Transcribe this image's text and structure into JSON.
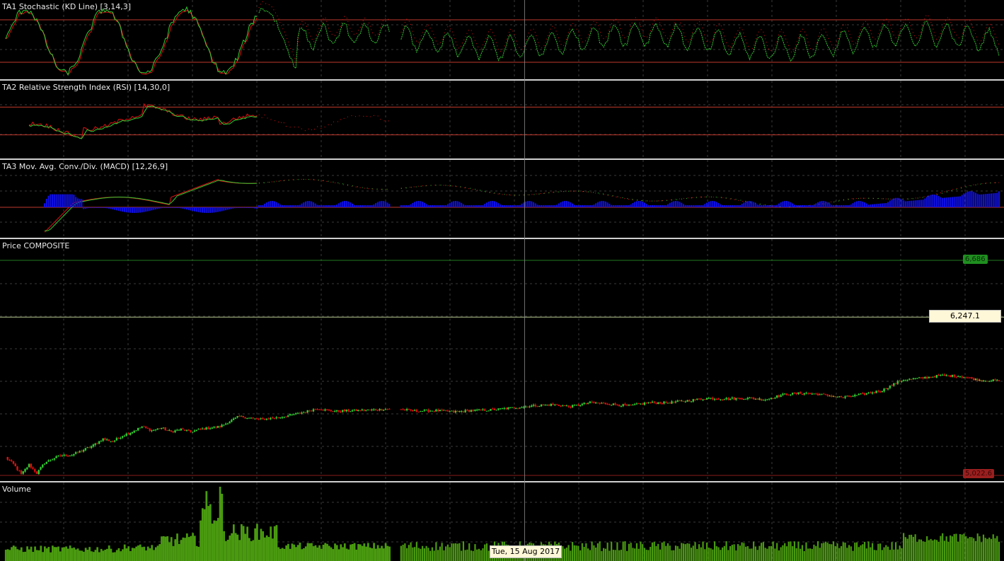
{
  "panels": {
    "stochastic": {
      "title": "TA1 Stochastic (KD Line) [3,14,3]",
      "upper_level": 80,
      "lower_level": 20
    },
    "rsi": {
      "title": "TA2 Relative Strength Index (RSI) [14,30,0]",
      "upper_level": 70,
      "lower_level": 30
    },
    "macd": {
      "title": "TA3 Mov. Avg. Conv./Div. (MACD) [12,26,9]"
    },
    "price": {
      "title": "Price COMPOSITE",
      "high_label": "6,686",
      "low_label": "5,022.6",
      "cursor_value": "6,247.1"
    },
    "volume": {
      "title": "Volume"
    }
  },
  "crosshair": {
    "date_label": "Tue, 15 Aug 2017"
  },
  "colors": {
    "up": "#33cc33",
    "down": "#e01010",
    "volume": "#4a9a10",
    "macd_hist": "#1010ee",
    "level_line": "#c0392b",
    "grid": "#3a3a3a"
  },
  "chart_data": [
    {
      "type": "candlestick",
      "title": "Price COMPOSITE",
      "ylim": [
        5022.6,
        6686
      ],
      "labels": {
        "high": "6,686",
        "low": "5,022.6",
        "cursor": "6,247.1"
      },
      "anchors": [
        [
          0,
          5160
        ],
        [
          4,
          5110
        ],
        [
          8,
          5030
        ],
        [
          12,
          5105
        ],
        [
          16,
          5040
        ],
        [
          20,
          5120
        ],
        [
          24,
          5150
        ],
        [
          28,
          5175
        ],
        [
          34,
          5180
        ],
        [
          40,
          5220
        ],
        [
          45,
          5255
        ],
        [
          50,
          5305
        ],
        [
          55,
          5285
        ],
        [
          60,
          5330
        ],
        [
          65,
          5360
        ],
        [
          70,
          5400
        ],
        [
          75,
          5370
        ],
        [
          80,
          5390
        ],
        [
          85,
          5360
        ],
        [
          90,
          5380
        ],
        [
          95,
          5360
        ],
        [
          100,
          5380
        ],
        [
          110,
          5400
        ],
        [
          120,
          5480
        ],
        [
          130,
          5455
        ],
        [
          140,
          5470
        ],
        [
          150,
          5500
        ],
        [
          160,
          5540
        ],
        [
          165,
          5525
        ],
        [
          170,
          5520
        ],
        [
          190,
          5530
        ],
        [
          200,
          5540
        ],
        [
          210,
          5520
        ],
        [
          220,
          5525
        ],
        [
          230,
          5515
        ],
        [
          240,
          5525
        ],
        [
          250,
          5530
        ],
        [
          260,
          5545
        ],
        [
          270,
          5560
        ],
        [
          280,
          5570
        ],
        [
          290,
          5555
        ],
        [
          300,
          5585
        ],
        [
          310,
          5575
        ],
        [
          320,
          5560
        ],
        [
          330,
          5585
        ],
        [
          340,
          5585
        ],
        [
          350,
          5600
        ],
        [
          360,
          5620
        ],
        [
          370,
          5615
        ],
        [
          380,
          5620
        ],
        [
          390,
          5610
        ],
        [
          400,
          5650
        ],
        [
          410,
          5660
        ],
        [
          420,
          5645
        ],
        [
          430,
          5625
        ],
        [
          440,
          5650
        ],
        [
          450,
          5680
        ],
        [
          460,
          5760
        ],
        [
          470,
          5775
        ],
        [
          480,
          5795
        ],
        [
          490,
          5790
        ],
        [
          500,
          5760
        ],
        [
          510,
          5755
        ]
      ],
      "n_candles": 511
    },
    {
      "type": "line",
      "title": "TA1 Stochastic (KD Line) [3,14,3]",
      "ylim": [
        0,
        100
      ],
      "levels": [
        80,
        20
      ],
      "series": [
        {
          "color": "#e01010",
          "solid_until": 130
        },
        {
          "color": "#33cc33",
          "solid_until": 130
        }
      ]
    },
    {
      "type": "line",
      "title": "TA2 Relative Strength Index (RSI) [14,30,0]",
      "ylim": [
        0,
        100
      ],
      "levels": [
        70,
        30
      ],
      "series": [
        {
          "color": "#e01010",
          "solid_until": 130
        },
        {
          "color": "#33cc33",
          "solid_until": 130
        }
      ]
    },
    {
      "type": "bar",
      "title": "TA3 Mov. Avg. Conv./Div. (MACD) [12,26,9]",
      "series": [
        {
          "color": "#e01010"
        },
        {
          "color": "#33cc33"
        },
        {
          "color": "#1010ee"
        }
      ]
    },
    {
      "type": "bar",
      "title": "Volume",
      "series": [
        {
          "color": "#4a9a10"
        }
      ]
    }
  ]
}
